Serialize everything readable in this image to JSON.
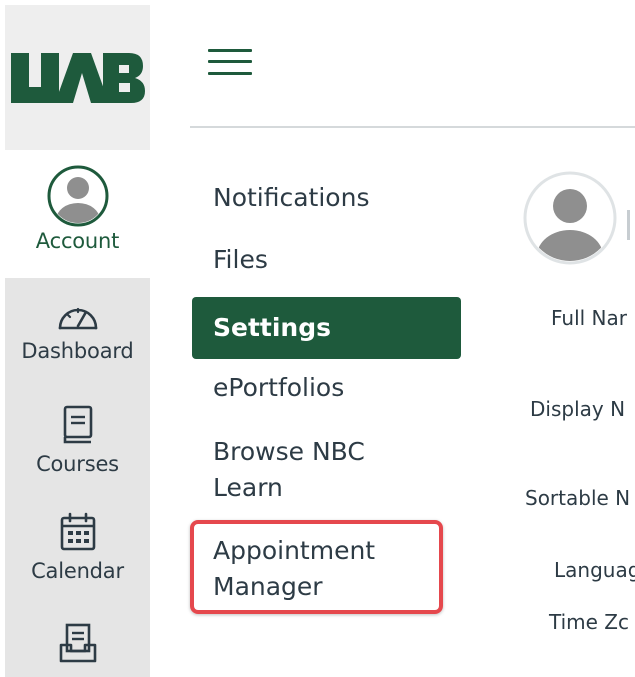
{
  "global_nav": {
    "logo_text": "UAB",
    "items": [
      {
        "label": "Account",
        "icon": "user-avatar-icon"
      },
      {
        "label": "Dashboard",
        "icon": "speedometer-icon"
      },
      {
        "label": "Courses",
        "icon": "book-icon"
      },
      {
        "label": "Calendar",
        "icon": "calendar-icon"
      },
      {
        "label": "",
        "icon": "inbox-icon"
      }
    ]
  },
  "header": {
    "menu_icon": "hamburger-icon"
  },
  "section_menu": {
    "items": [
      {
        "label": "Notifications"
      },
      {
        "label": "Files"
      },
      {
        "label": "Settings",
        "active": true
      },
      {
        "label": "ePortfolios"
      },
      {
        "label_line1": "Browse NBC",
        "label_line2": "Learn"
      },
      {
        "label_line1": "Appointment",
        "label_line2": "Manager",
        "highlighted": true
      }
    ]
  },
  "profile": {
    "field_labels": [
      "Full Nar",
      "Display N",
      "Sortable N",
      "Languag",
      "Time Zc"
    ]
  },
  "colors": {
    "brand": "#1e5a3c",
    "highlight": "#e5484d",
    "text": "#2d3b45"
  }
}
